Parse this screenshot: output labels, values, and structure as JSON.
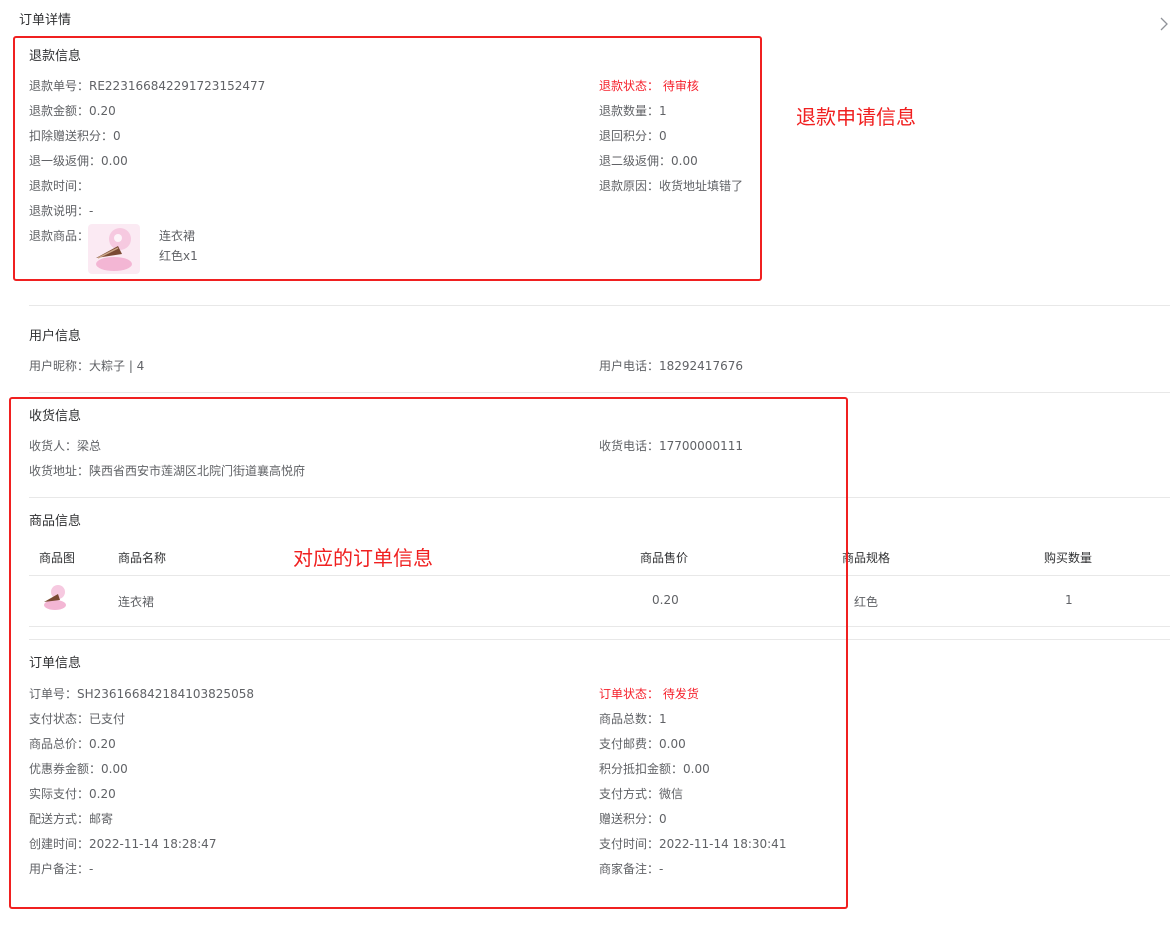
{
  "page": {
    "title": "订单详情"
  },
  "refund": {
    "section_title": "退款信息",
    "order_no": "退款单号：RE223166842291723152477",
    "status": "退款状态： 待审核",
    "amount": "退款金额：0.20",
    "quantity": "退款数量：1",
    "deduct_points": "扣除赠送积分：0",
    "return_points": "退回积分：0",
    "commission1": "退一级返佣：0.00",
    "commission2": "退二级返佣：0.00",
    "time": "退款时间：",
    "reason": "退款原因：收货地址填错了",
    "note": "退款说明：-",
    "goods_label": "退款商品：",
    "goods_name": "连衣裙",
    "goods_spec": "红色x1"
  },
  "user": {
    "section_title": "用户信息",
    "nickname": "用户昵称：大粽子 | 4",
    "phone": "用户电话：18292417676"
  },
  "shipping": {
    "section_title": "收货信息",
    "receiver": "收货人：梁总",
    "phone": "收货电话：17700000111",
    "address": "收货地址：陕西省西安市莲湖区北院门街道襄高悦府"
  },
  "goods": {
    "section_title": "商品信息",
    "headers": [
      "商品图",
      "商品名称",
      "商品售价",
      "商品规格",
      "购买数量"
    ],
    "rows": [
      {
        "name": "连衣裙",
        "price": "0.20",
        "spec": "红色",
        "qty": "1"
      }
    ]
  },
  "order": {
    "section_title": "订单信息",
    "order_no": "订单号：SH236166842184103825058",
    "status": "订单状态： 待发货",
    "pay_status": "支付状态：已支付",
    "total_count": "商品总数：1",
    "total_price": "商品总价：0.20",
    "postage": "支付邮费：0.00",
    "coupon": "优惠券金额：0.00",
    "points_deduct": "积分抵扣金额：0.00",
    "actual_pay": "实际支付：0.20",
    "pay_method": "支付方式：微信",
    "delivery": "配送方式：邮寄",
    "gift_points": "赠送积分：0",
    "create_time": "创建时间：2022-11-14 18:28:47",
    "pay_time": "支付时间：2022-11-14 18:30:41",
    "user_note": "用户备注：-",
    "merchant_note": "商家备注：-"
  },
  "annotations": {
    "refund_label": "退款申请信息",
    "order_label": "对应的订单信息"
  },
  "colors": {
    "accent_red": "#f5222d",
    "box_red": "#f02020"
  }
}
